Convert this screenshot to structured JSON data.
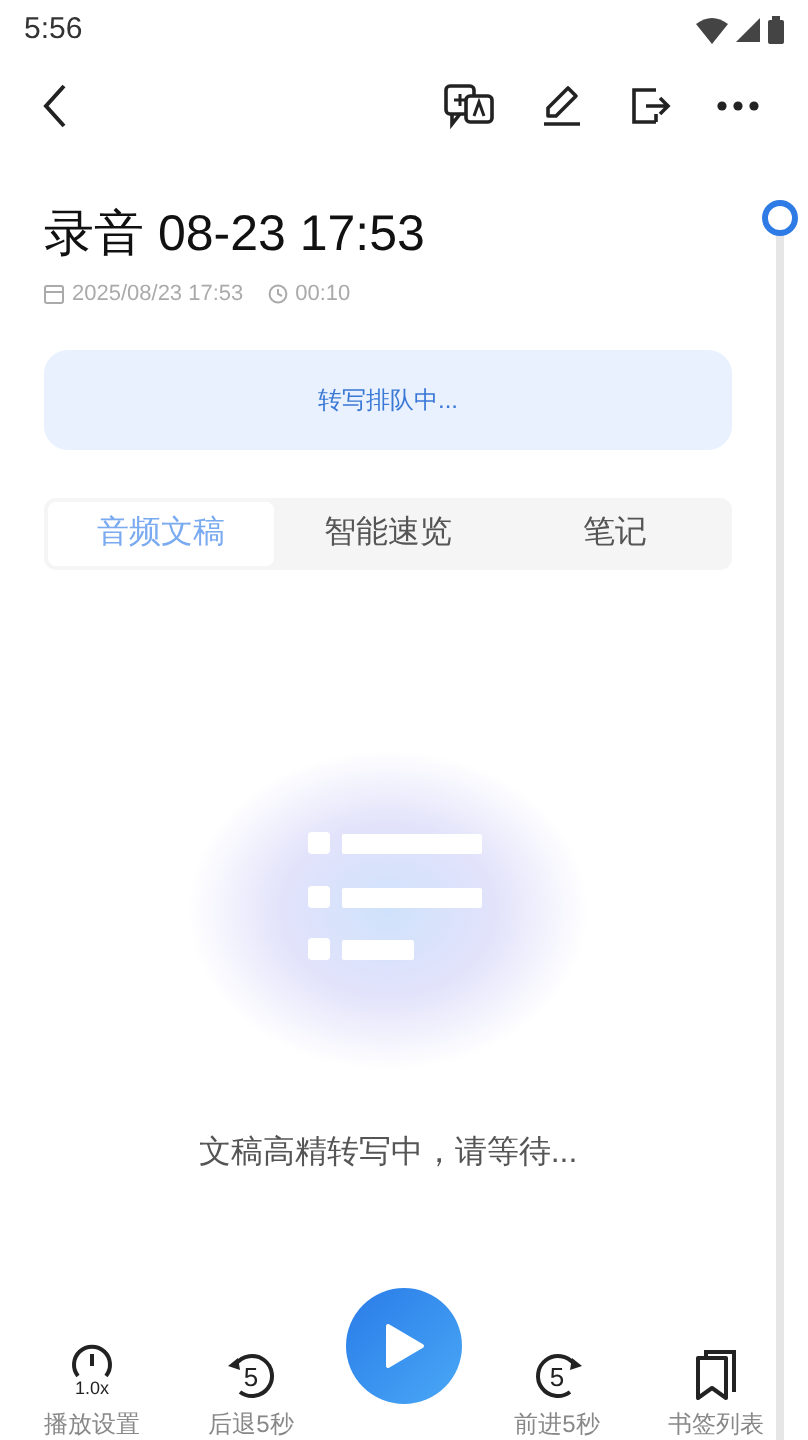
{
  "status_bar": {
    "time": "5:56"
  },
  "title": "录音 08-23 17:53",
  "meta": {
    "date": "2025/08/23 17:53",
    "duration": "00:10"
  },
  "banner": "转写排队中...",
  "tabs": [
    {
      "label": "音频文稿",
      "selected": true
    },
    {
      "label": "智能速览",
      "selected": false
    },
    {
      "label": "笔记",
      "selected": false
    }
  ],
  "empty_message": "文稿高精转写中，请等待...",
  "controls": [
    {
      "kind": "speed",
      "icon_text": "1.0x",
      "label": "播放设置"
    },
    {
      "kind": "back",
      "icon_text": "5",
      "label": "后退5秒"
    },
    {
      "kind": "play"
    },
    {
      "kind": "forward",
      "icon_text": "5",
      "label": "前进5秒"
    },
    {
      "kind": "bookmarks",
      "label": "书签列表"
    }
  ]
}
